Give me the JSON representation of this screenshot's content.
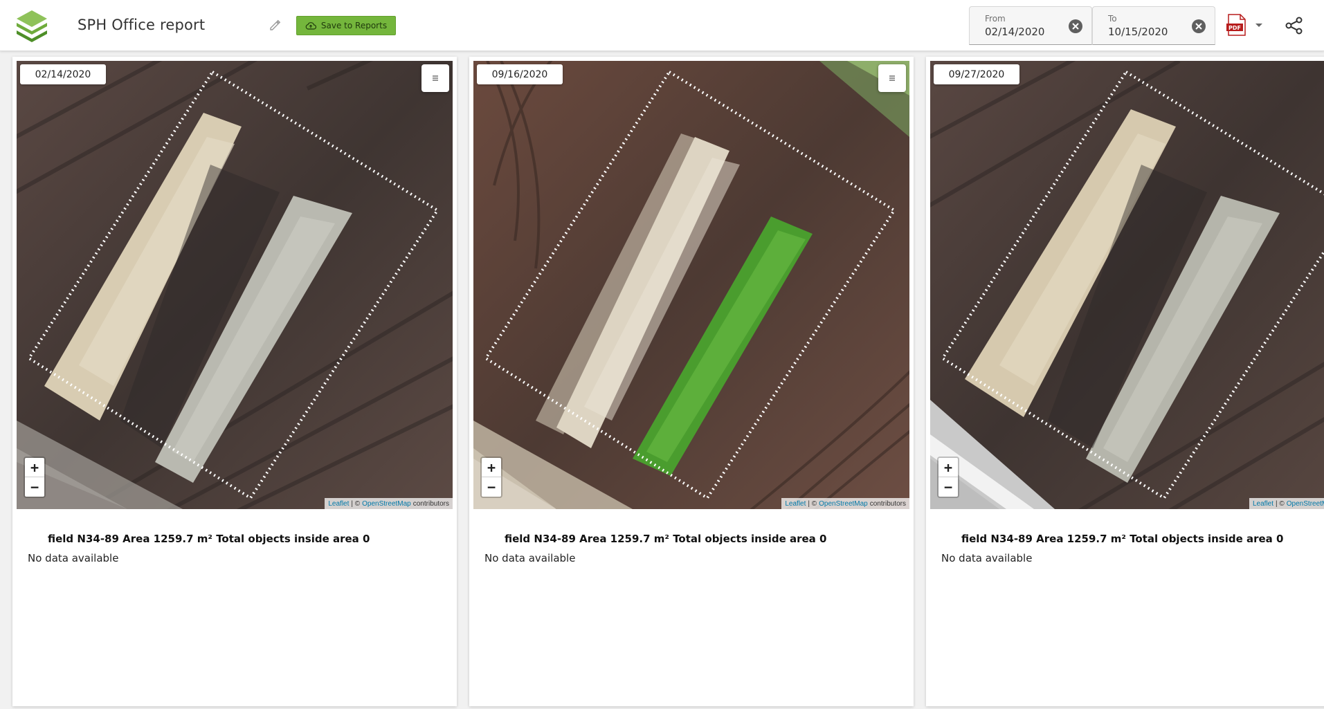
{
  "header": {
    "title": "SPH Office report",
    "save_label": "Save to Reports",
    "from": {
      "label": "From",
      "value": "02/14/2020"
    },
    "to": {
      "label": "To",
      "value": "10/15/2020"
    }
  },
  "icons": {
    "logo": "layers-logo-icon",
    "edit": "pencil-icon",
    "save": "cloud-upload-icon",
    "clear": "clear-circle-icon",
    "pdf": "pdf-file-icon",
    "caret": "chevron-down-icon",
    "share": "share-icon",
    "layers": "layers-control-icon"
  },
  "colors": {
    "brand_green": "#74b63c",
    "pdf_red": "#b71c1c",
    "link_blue": "#0078a8"
  },
  "attribution": {
    "leaflet": "Leaflet",
    "separator": "| ©",
    "osm": "OpenStreetMap",
    "contributors": "contributors"
  },
  "zoom": {
    "in": "+",
    "out": "−"
  },
  "panels": [
    {
      "date": "02/14/2020",
      "has_layer_control": true,
      "field_info": "field N34-89 Area 1259.7 m² Total objects inside area 0",
      "status": "No data available"
    },
    {
      "date": "09/16/2020",
      "has_layer_control": true,
      "field_info": "field N34-89 Area 1259.7 m² Total objects inside area 0",
      "status": "No data available"
    },
    {
      "date": "09/27/2020",
      "has_layer_control": false,
      "field_info": "field N34-89 Area 1259.7 m² Total objects inside area 0",
      "status": "No data available"
    }
  ]
}
